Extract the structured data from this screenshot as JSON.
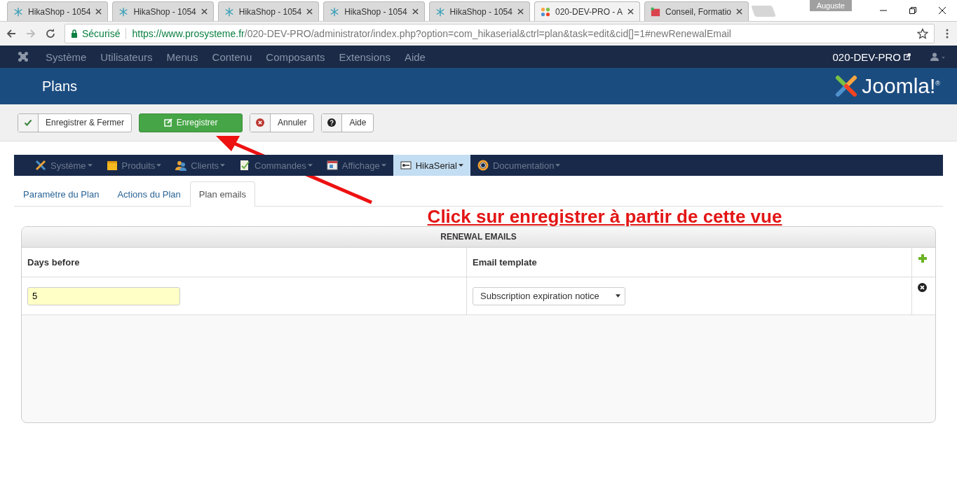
{
  "browser": {
    "tabs": [
      {
        "title": "HikaShop - 1054",
        "kind": "hika",
        "selected": false
      },
      {
        "title": "HikaShop - 1054",
        "kind": "hika",
        "selected": false
      },
      {
        "title": "HikaShop - 1054",
        "kind": "hika",
        "selected": false
      },
      {
        "title": "HikaShop - 1054",
        "kind": "hika",
        "selected": false
      },
      {
        "title": "HikaShop - 1054",
        "kind": "hika",
        "selected": false
      },
      {
        "title": "020-DEV-PRO - A",
        "kind": "joomla",
        "selected": true
      },
      {
        "title": "Conseil, Formatio",
        "kind": "image",
        "selected": false
      }
    ],
    "profile": "Auguste",
    "address": {
      "secure_label": "Sécurisé",
      "host": "https://www.prosysteme.fr",
      "path": "/020-DEV-PRO/administrator/index.php?option=com_hikaserial&ctrl=plan&task=edit&cid[]=1#newRenewalEmail"
    }
  },
  "top_menu": {
    "items": [
      "Système",
      "Utilisateurs",
      "Menus",
      "Contenu",
      "Composants",
      "Extensions",
      "Aide"
    ],
    "site_link": "020-DEV-PRO"
  },
  "header": {
    "title": "Plans",
    "logo": "Joomla!$^{®}$"
  },
  "toolbar": [
    {
      "kind": "save-close",
      "label": "Enregistrer & Fermer",
      "primary": false
    },
    {
      "kind": "save",
      "label": "Enregistrer",
      "primary": true
    },
    {
      "kind": "cancel",
      "label": "Annuler",
      "primary": false
    },
    {
      "kind": "help",
      "label": "Aide",
      "primary": false
    }
  ],
  "sub_menu": [
    {
      "kind": "tools",
      "label": "Système",
      "selected": false
    },
    {
      "kind": "box",
      "label": "Produits",
      "selected": false
    },
    {
      "kind": "users",
      "label": "Clients",
      "selected": false
    },
    {
      "kind": "orders",
      "label": "Commandes",
      "selected": false
    },
    {
      "kind": "display",
      "label": "Affichage",
      "selected": false
    },
    {
      "kind": "serial",
      "label": "HikaSerial",
      "selected": true
    },
    {
      "kind": "help",
      "label": "Documentation",
      "selected": false
    }
  ],
  "tabs": [
    {
      "label": "Paramètre du Plan",
      "selected": false
    },
    {
      "label": "Actions du Plan",
      "selected": false
    },
    {
      "label": "Plan emails",
      "selected": true
    }
  ],
  "annotation": "Click sur enregistrer à partir de cette vue",
  "panel": {
    "title": "RENEWAL EMAILS",
    "columns": [
      "Days before",
      "Email template"
    ],
    "rows": [
      {
        "days": "5",
        "template": "Subscription expiration notice"
      }
    ]
  }
}
